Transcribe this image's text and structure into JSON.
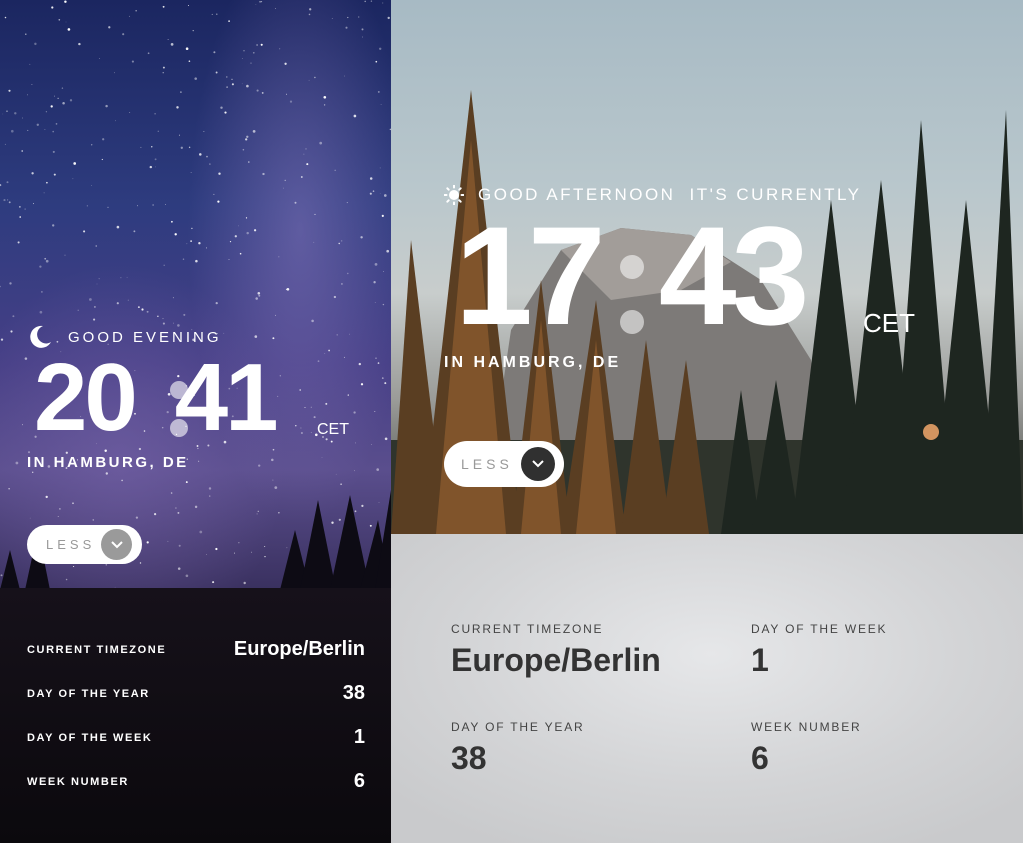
{
  "mobile": {
    "greeting": "GOOD EVENING",
    "greeting_icon": "moon-icon",
    "hour": "20",
    "minute": "41",
    "timezone_abbr": "CET",
    "location": "IN HAMBURG, DE",
    "toggle_label": "LESS",
    "toggle_icon": "chevron-down-icon",
    "details": [
      {
        "label": "CURRENT TIMEZONE",
        "value": "Europe/Berlin"
      },
      {
        "label": "DAY OF THE YEAR",
        "value": "38"
      },
      {
        "label": "DAY OF THE WEEK",
        "value": "1"
      },
      {
        "label": "WEEK NUMBER",
        "value": "6"
      }
    ]
  },
  "tablet": {
    "greeting": "GOOD AFTERNOON",
    "greeting_suffix": "IT'S CURRENTLY",
    "greeting_icon": "sun-icon",
    "hour": "17",
    "minute": "43",
    "timezone_abbr": "CET",
    "location": "IN HAMBURG, DE",
    "toggle_label": "LESS",
    "toggle_icon": "chevron-down-icon",
    "details": [
      {
        "label": "CURRENT TIMEZONE",
        "value": "Europe/Berlin"
      },
      {
        "label": "DAY OF THE WEEK",
        "value": "1"
      },
      {
        "label": "DAY OF THE YEAR",
        "value": "38"
      },
      {
        "label": "WEEK NUMBER",
        "value": "6"
      }
    ]
  },
  "colors": {
    "night_panel": "#0b090d",
    "day_panel": "#d3d4d6",
    "toggle_chevron_mobile": "#9a9a9a",
    "toggle_chevron_tablet": "#303030"
  }
}
